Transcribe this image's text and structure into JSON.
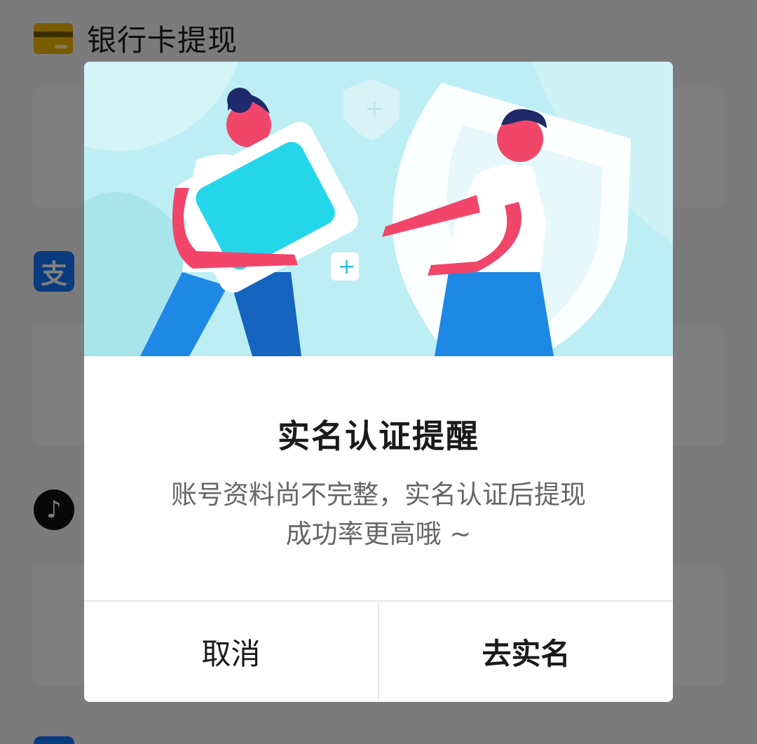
{
  "background": {
    "bank_section_title": "银行卡提现",
    "alipay_icon_glyph": "支",
    "douyin_icon_glyph": "♪"
  },
  "dialog": {
    "title": "实名认证提醒",
    "message_line1": "账号资料尚不完整，实名认证后提现",
    "message_line2": "成功率更高哦 ~",
    "cancel_label": "取消",
    "confirm_label": "去实名"
  },
  "colors": {
    "overlay": "rgba(0,0,0,0.5)",
    "illustration_bg": "#bdeef4",
    "accent_pink": "#f2456a",
    "accent_blue": "#1e88e5"
  }
}
